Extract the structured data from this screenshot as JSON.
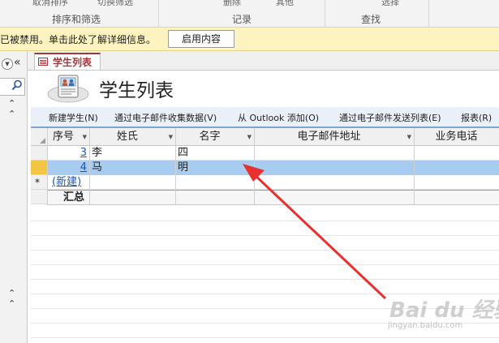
{
  "ribbon": {
    "cut_labels": [
      "取消排序",
      "切换筛选",
      "删除",
      "其他",
      "选择"
    ],
    "groups": [
      "排序和筛选",
      "记录",
      "查找"
    ]
  },
  "security_bar": {
    "message": "已被禁用。单击此处了解详细信息。",
    "enable_button": "启用内容"
  },
  "nav_pane": {
    "collapse_glyph": "«",
    "search_icon": "search-icon",
    "up_glyph": "⌃"
  },
  "tab": {
    "label": "学生列表",
    "icon": "form-icon"
  },
  "form": {
    "title": "学生列表",
    "icon": "students-icon"
  },
  "commands": [
    "新建学生(N)",
    "通过电子邮件收集数据(V)",
    "从 Outlook 添加(O)",
    "通过电子邮件发送列表(E)",
    "报表(R)"
  ],
  "table": {
    "columns": [
      "序号",
      "姓氏",
      "名字",
      "电子邮件地址",
      "业务电话"
    ],
    "rows": [
      {
        "id": "3",
        "last": "李",
        "first": "四",
        "email": "",
        "phone": ""
      },
      {
        "id": "4",
        "last": "马",
        "first": "明",
        "email": "",
        "phone": ""
      }
    ],
    "new_row_label": "(新建)",
    "new_row_marker": "*",
    "totals_label": "汇总"
  },
  "annotation": {
    "color": "#e8312f"
  },
  "watermark": {
    "text": "Bai du 经验",
    "url": "jingyan.baidu.com"
  },
  "colors": {
    "selected_row": "#a8ccef",
    "tab_accent": "#a4373a",
    "security_bar": "#fcf3c0"
  }
}
